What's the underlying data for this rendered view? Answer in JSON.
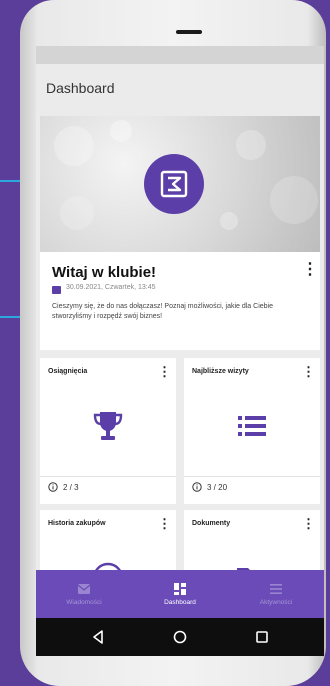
{
  "appbar": {
    "title": "Dashboard"
  },
  "welcome": {
    "title": "Witaj w klubie!",
    "date": "30.09.2021, Czwartek, 13:45",
    "text": "Cieszymy się, że do nas dołączasz! Poznaj możliwości, jakie dla Ciebie stworzyliśmy i rozpędź swój biznes!",
    "more_label": "⋮"
  },
  "cards": [
    {
      "title": "Osiągnięcia",
      "count": "2 / 3",
      "icon": "trophy-icon"
    },
    {
      "title": "Najbliższe wizyty",
      "count": "3 / 20",
      "icon": "list-icon"
    },
    {
      "title": "Historia zakupów",
      "icon": "add-circle-icon"
    },
    {
      "title": "Dokumenty",
      "icon": "folder-icon"
    }
  ],
  "nav": {
    "items": [
      {
        "label": "Wiadomości",
        "icon": "mail-icon",
        "active": false
      },
      {
        "label": "Dashboard",
        "icon": "dashboard-icon",
        "active": true
      },
      {
        "label": "Aktywności",
        "icon": "list-icon",
        "active": false
      }
    ]
  },
  "colors": {
    "accent": "#5c3ea8",
    "nav_bg": "#6a4bb8",
    "page_bg": "#5a3e99"
  }
}
